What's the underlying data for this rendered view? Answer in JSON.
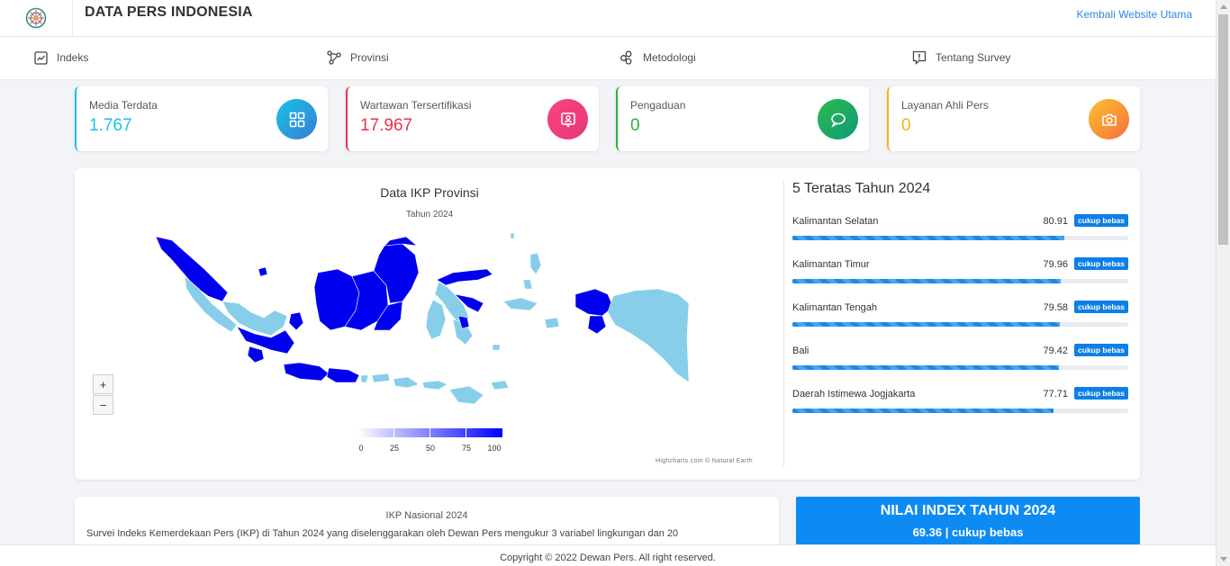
{
  "header": {
    "site_title": "DATA PERS INDONESIA",
    "back_link": "Kembali Website Utama"
  },
  "nav": [
    {
      "label": "Indeks",
      "icon": "line-chart-icon"
    },
    {
      "label": "Provinsi",
      "icon": "network-icon"
    },
    {
      "label": "Metodologi",
      "icon": "circles-icon"
    },
    {
      "label": "Tentang Survey",
      "icon": "info-message-icon"
    }
  ],
  "stats": [
    {
      "label": "Media Terdata",
      "value": "1.767",
      "color": "#1fc1e3",
      "icon": "grid-icon"
    },
    {
      "label": "Wartawan Tersertifikasi",
      "value": "17.967",
      "color": "#e8324f",
      "icon": "id-card-icon"
    },
    {
      "label": "Pengaduan",
      "value": "0",
      "color": "#2cb23a",
      "icon": "chat-icon"
    },
    {
      "label": "Layanan Ahli Pers",
      "value": "0",
      "color": "#f5b223",
      "icon": "camera-icon"
    }
  ],
  "map": {
    "title": "Data IKP Provinsi",
    "subtitle": "Tahun 2024",
    "zoom_in": "+",
    "zoom_out": "−",
    "legend": [
      "0",
      "25",
      "50",
      "75",
      "100"
    ],
    "credit": "Highcharts.com © Natural Earth",
    "colors": {
      "high": "#0000ee",
      "mid": "#87ceeb"
    }
  },
  "top5": {
    "title": "5 Teratas Tahun 2024",
    "items": [
      {
        "name": "Kalimantan Selatan",
        "score": "80.91",
        "badge": "cukup bebas",
        "pct": 80.91
      },
      {
        "name": "Kalimantan Timur",
        "score": "79.96",
        "badge": "cukup bebas",
        "pct": 79.96
      },
      {
        "name": "Kalimantan Tengah",
        "score": "79.58",
        "badge": "cukup bebas",
        "pct": 79.58
      },
      {
        "name": "Bali",
        "score": "79.42",
        "badge": "cukup bebas",
        "pct": 79.42
      },
      {
        "name": "Daerah Istimewa Jogjakarta",
        "score": "77.71",
        "badge": "cukup bebas",
        "pct": 77.71
      }
    ]
  },
  "about": {
    "title": "IKP Nasional 2024",
    "text": "Survei Indeks Kemerdekaan Pers (IKP) di Tahun 2024 yang diselenggarakan oleh Dewan Pers mengukur 3 variabel lingkungan dan 20"
  },
  "index": {
    "title": "NILAI INDEX TAHUN 2024",
    "value": "69.36 | cukup bebas"
  },
  "footer": {
    "copyright": "Copyright © 2022 Dewan Pers. All right reserved."
  }
}
